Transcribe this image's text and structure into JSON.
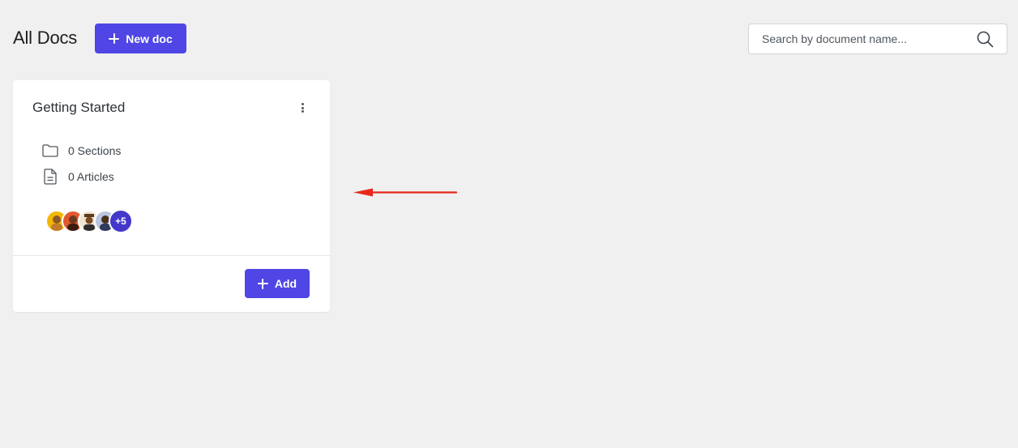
{
  "header": {
    "title": "All Docs",
    "new_doc_label": "New doc",
    "search_placeholder": "Search by document name..."
  },
  "doc_card": {
    "title": "Getting Started",
    "sections_text": "0 Sections",
    "articles_text": "0 Articles",
    "contributors_more": "+5",
    "add_label": "Add"
  },
  "colors": {
    "accent": "#4f46e5",
    "badge": "#4338ca",
    "annotation_arrow": "#e8271b",
    "page_bg": "#f0f0f1"
  }
}
